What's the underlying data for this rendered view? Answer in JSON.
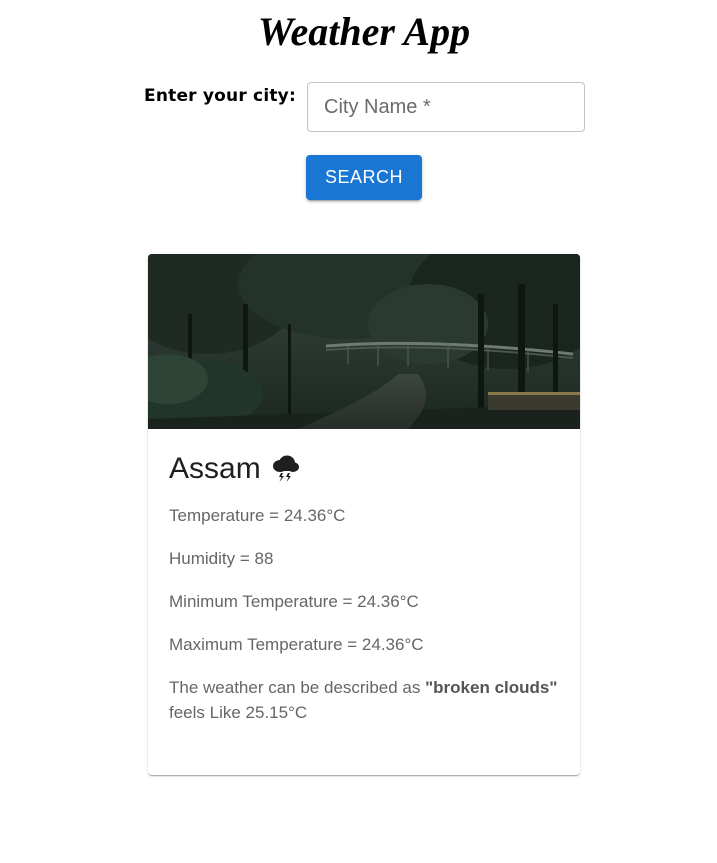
{
  "header": {
    "title": "Weather App"
  },
  "search": {
    "label": "Enter your city:",
    "placeholder": "City Name *",
    "button_label": "SEARCH"
  },
  "card": {
    "city": "Assam",
    "weather_icon": "thunderstorm-cloud-icon",
    "image_description_icon": "forest-bridge-rain-image",
    "temperature_label": "Temperature = ",
    "temperature": "24.36°C",
    "humidity_label": "Humidity = ",
    "humidity": "88",
    "min_label": "Minimum Temperature = ",
    "min_temp": "24.36°C",
    "max_label": "Maximum Temperature = ",
    "max_temp": "24.36°C",
    "desc_prefix": "The weather can be described as ",
    "desc_value": "\"broken clouds\"",
    "desc_suffix": " feels Like 25.15°C"
  },
  "colors": {
    "accent": "#1976d2",
    "text_secondary": "#666666",
    "text_primary": "#1f1f1f"
  }
}
